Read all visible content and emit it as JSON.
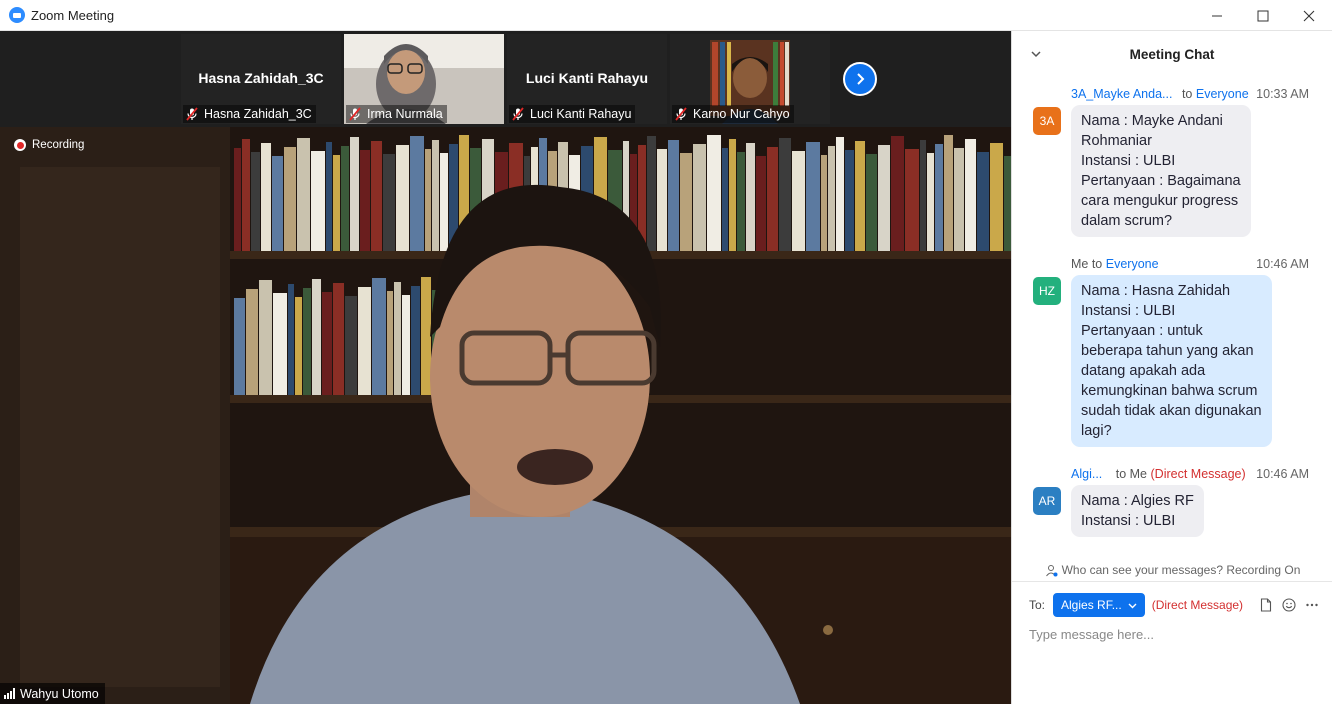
{
  "window": {
    "title": "Zoom Meeting"
  },
  "thumbnails": [
    {
      "display_name": "Hasna Zahidah_3C",
      "label": "Hasna Zahidah_3C",
      "has_video": false
    },
    {
      "display_name": "",
      "label": "Irma Nurmala",
      "has_video": true
    },
    {
      "display_name": "Luci Kanti Rahayu",
      "label": "Luci Kanti Rahayu",
      "has_video": false
    },
    {
      "display_name": "",
      "label": "Karno Nur Cahyo",
      "has_video": true
    }
  ],
  "main_video": {
    "recording_label": "Recording",
    "speaker_name": "Wahyu Utomo"
  },
  "chat": {
    "header": "Meeting Chat",
    "messages": [
      {
        "avatar": "3A",
        "avatar_color": "#e8711a",
        "sender": "3A_Mayke Anda...",
        "to_text": "to",
        "target": "Everyone",
        "dm": "",
        "time": "10:33 AM",
        "lines": [
          "Nama : Mayke Andani",
          "Rohmaniar",
          "Instansi : ULBI",
          "Pertanyaan : Bagaimana",
          "cara mengukur progress",
          "dalam scrum?"
        ],
        "style": "grey"
      },
      {
        "avatar": "HZ",
        "avatar_color": "#23b07d",
        "sender": "",
        "to_text": "Me to",
        "target": "Everyone",
        "dm": "",
        "time": "10:46 AM",
        "lines": [
          "Nama : Hasna Zahidah",
          "Instansi : ULBI",
          "Pertanyaan : untuk",
          "beberapa tahun yang akan",
          "datang apakah ada",
          "kemungkinan bahwa scrum",
          "sudah tidak akan digunakan",
          "lagi?"
        ],
        "style": "blue"
      },
      {
        "avatar": "AR",
        "avatar_color": "#2b7fc2",
        "sender": "Algi...",
        "to_text": "to Me",
        "target": "",
        "dm": "(Direct Message)",
        "time": "10:46 AM",
        "lines": [
          "Nama : Algies RF",
          "Instansi : ULBI"
        ],
        "style": "grey"
      }
    ],
    "visibility_note": "Who can see your messages? Recording On",
    "compose": {
      "to_label": "To:",
      "recipient": "Algies RF...",
      "dm_label": "(Direct Message)",
      "placeholder": "Type message here..."
    }
  },
  "colors": {
    "accent": "#0e72ed",
    "recording": "#e02828",
    "dm": "#d32f2f"
  }
}
